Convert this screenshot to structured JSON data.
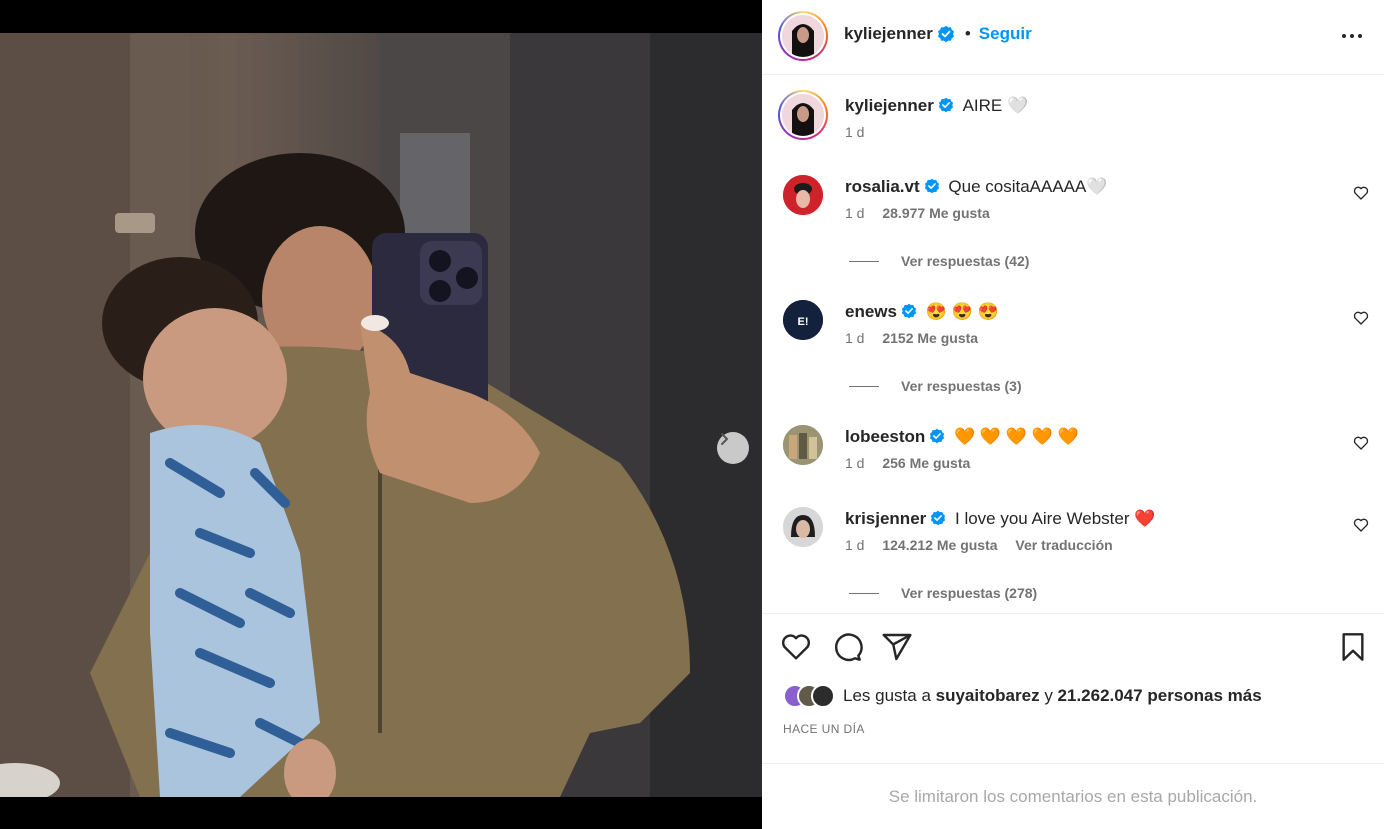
{
  "post": {
    "author": "kyliejenner",
    "follow_label": "Seguir",
    "caption": "AIRE",
    "caption_emoji": "🤍",
    "caption_age": "1 d"
  },
  "carousel": {
    "total_slides": 4,
    "active_slide": 1
  },
  "comments": [
    {
      "user": "rosalia.vt",
      "text": "Que cositaAAAAA",
      "emoji": "🤍",
      "age": "1 d",
      "likes": "28.977 Me gusta",
      "replies": "Ver respuestas (42)"
    },
    {
      "user": "enews",
      "text": "",
      "emoji": "😍 😍 😍",
      "age": "1 d",
      "likes": "2152 Me gusta",
      "replies": "Ver respuestas (3)"
    },
    {
      "user": "lobeeston",
      "text": "",
      "emoji": "🧡 🧡 🧡 🧡 🧡",
      "age": "1 d",
      "likes": "256 Me gusta"
    },
    {
      "user": "krisjenner",
      "text": "I love you Aire Webster",
      "emoji": "❤️",
      "age": "1 d",
      "likes": "124.212 Me gusta",
      "translate": "Ver traducción",
      "replies": "Ver respuestas (278)"
    }
  ],
  "likes_summary": {
    "prefix": "Les gusta a",
    "user": "suyaitobarez",
    "conj": "y",
    "count": "21.262.047 personas más"
  },
  "timestamp": "HACE UN DÍA",
  "comments_limited": "Se limitaron los comentarios en esta publicación.",
  "colors": {
    "accent": "#0095f6",
    "verified": "#0095f6",
    "muted": "#737373"
  },
  "icons": [
    "chevron-right-icon",
    "more-icon",
    "verified-icon",
    "heart-icon",
    "comment-icon",
    "share-icon",
    "bookmark-icon"
  ]
}
